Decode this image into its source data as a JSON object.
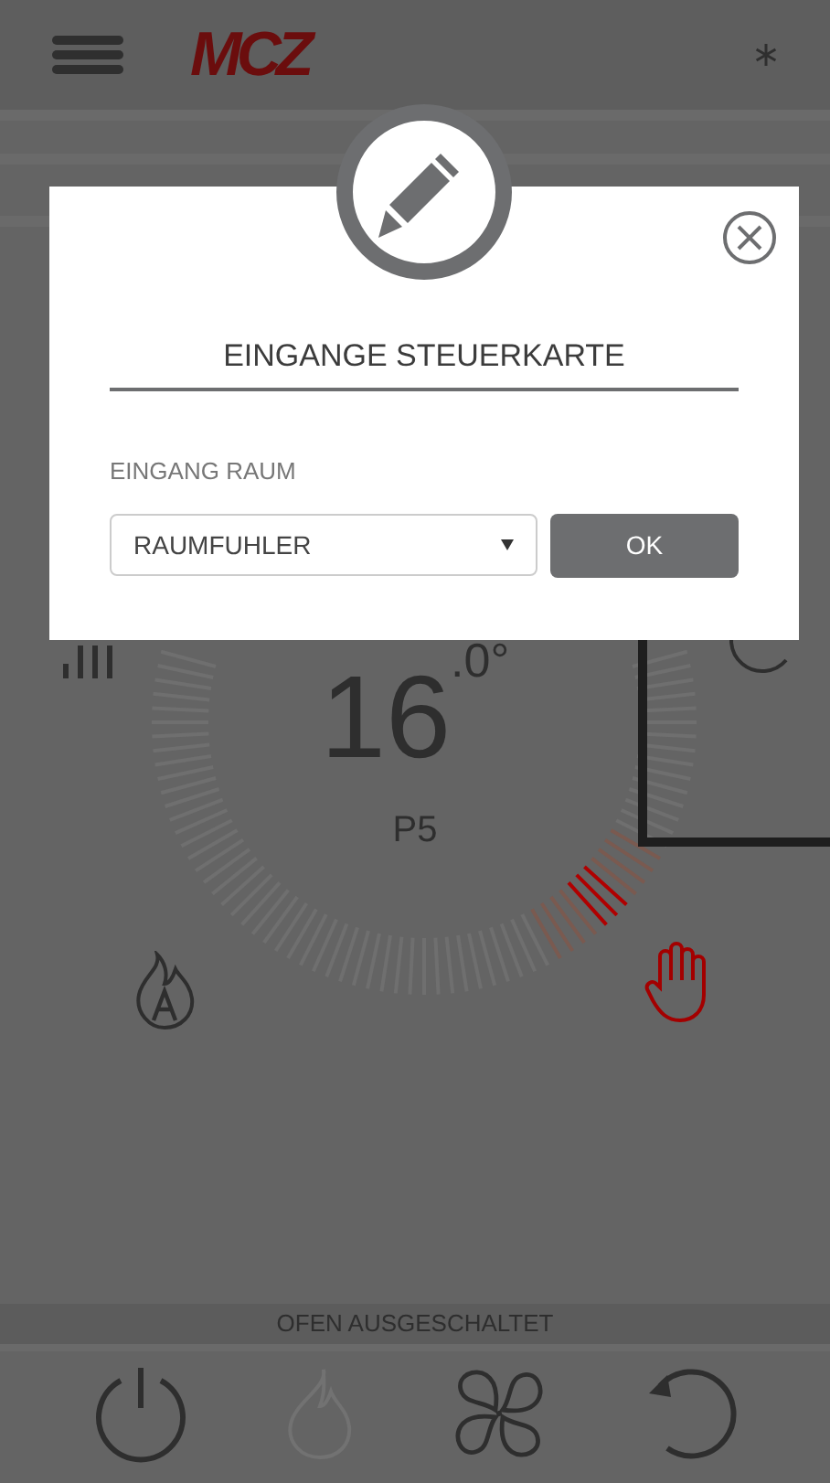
{
  "header": {
    "logo": "MCZ"
  },
  "dial": {
    "temperature": "16$^{.0°}$",
    "power": "P5"
  },
  "modes": [
    {
      "kind": "bars",
      "selected": false
    },
    {
      "kind": "moon",
      "selected": false
    },
    {
      "kind": "auto",
      "selected": false
    },
    {
      "kind": "manual",
      "selected": true
    }
  ],
  "status_bar": {
    "text": "OFEN AUSGESCHALTET"
  },
  "bottom_bar": {
    "buttons": [
      {
        "kind": "power",
        "disabled": false
      },
      {
        "kind": "flame",
        "disabled": true
      },
      {
        "kind": "fan",
        "disabled": false
      },
      {
        "kind": "reset",
        "disabled": false
      }
    ]
  },
  "dialog": {
    "title": "EINGANGE STEUERKARTE",
    "field_label": "EINGANG RAUM",
    "select": {
      "value": "RAUMFUHLER"
    },
    "ok_button": "OK"
  }
}
